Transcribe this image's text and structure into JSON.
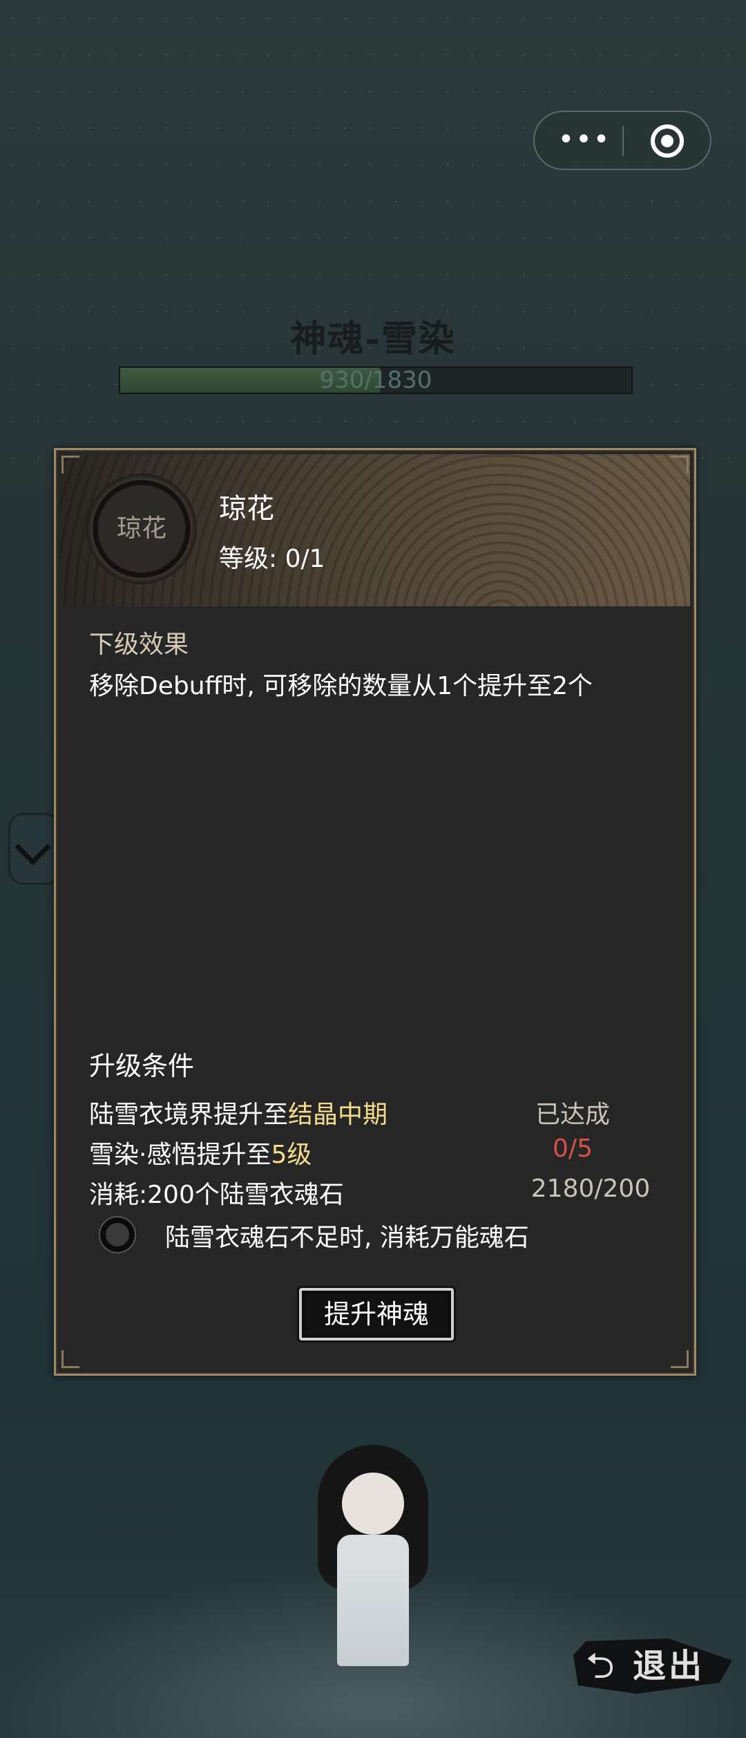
{
  "header": {
    "soul_title": "神魂-雪染",
    "exp_text": "930/1830",
    "exp_progress": 0.508
  },
  "capsule": {
    "more_icon": "more-dots-icon",
    "close_icon": "target-circle-icon"
  },
  "panel": {
    "skill_icon_label": "琼花",
    "skill_name": "琼花",
    "level_text": "等级: 0/1",
    "next_effect_label": "下级效果",
    "next_effect_text": "移除Debuff时, 可移除的数量从1个提升至2个",
    "conditions_title": "升级条件",
    "conditions": [
      {
        "prefix": "陆雪衣境界提升至",
        "highlight": "结晶中期",
        "status": "已达成"
      },
      {
        "prefix": "雪染·感悟提升至",
        "highlight": "5级",
        "status": "0/5"
      },
      {
        "prefix": "消耗:200个陆雪衣魂石",
        "highlight": "",
        "status": "2180/200"
      }
    ],
    "toggle_label": "陆雪衣魂石不足时, 消耗万能魂石",
    "upgrade_button": "提升神魂"
  },
  "footer": {
    "exit_label": "退出",
    "exit_icon": "return-arrow-icon"
  },
  "colors": {
    "highlight": "#f5dc8a",
    "unmet": "#d9514a",
    "panel_border": "#9e8a66"
  }
}
